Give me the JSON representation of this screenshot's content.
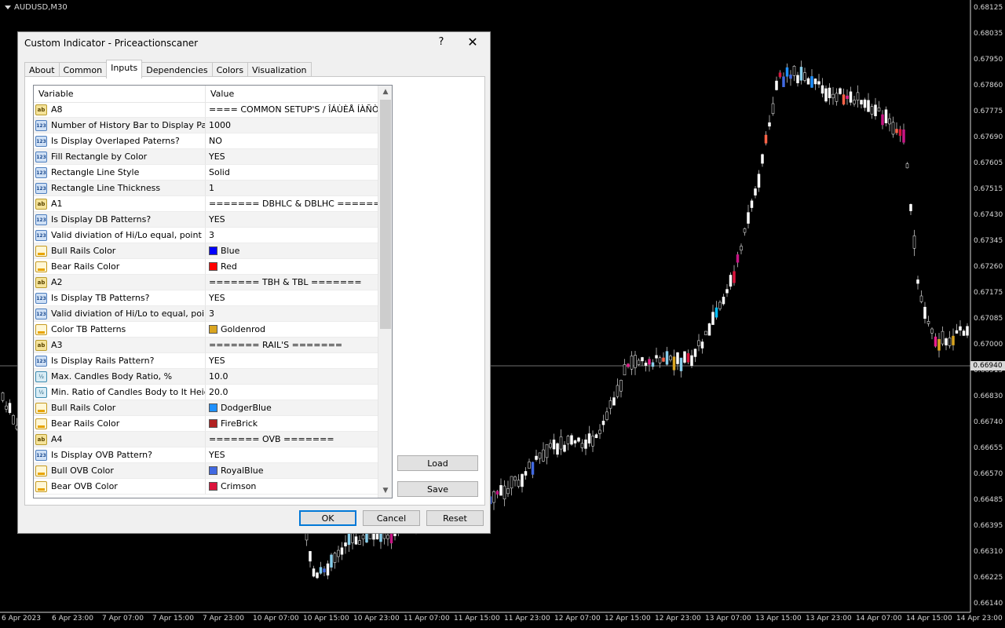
{
  "chart": {
    "symbol_title": "AUDUSD,M30",
    "current_price": "0.66940",
    "y_axis_labels": [
      "0.68125",
      "0.68035",
      "0.67950",
      "0.67860",
      "0.67775",
      "0.67690",
      "0.67605",
      "0.67515",
      "0.67430",
      "0.67345",
      "0.67260",
      "0.67175",
      "0.67085",
      "0.67000",
      "0.66915",
      "0.66830",
      "0.66740",
      "0.66655",
      "0.66570",
      "0.66485",
      "0.66395",
      "0.66310",
      "0.66225",
      "0.66140"
    ],
    "x_axis_labels": [
      "6 Apr 2023",
      "6 Apr 23:00",
      "7 Apr 07:00",
      "7 Apr 15:00",
      "7 Apr 23:00",
      "10 Apr 07:00",
      "10 Apr 15:00",
      "10 Apr 23:00",
      "11 Apr 07:00",
      "11 Apr 15:00",
      "11 Apr 23:00",
      "12 Apr 07:00",
      "12 Apr 15:00",
      "12 Apr 23:00",
      "13 Apr 07:00",
      "13 Apr 15:00",
      "13 Apr 23:00",
      "14 Apr 07:00",
      "14 Apr 15:00",
      "14 Apr 23:00"
    ]
  },
  "dialog": {
    "title": "Custom Indicator - Priceactionscaner",
    "help_label": "?",
    "close_label": "✕",
    "tabs": [
      "About",
      "Common",
      "Inputs",
      "Dependencies",
      "Colors",
      "Visualization"
    ],
    "active_tab": "Inputs",
    "grid": {
      "col_variable": "Variable",
      "col_value": "Value",
      "rows": [
        {
          "icon": "ab",
          "variable": "A8",
          "value": "==== COMMON SETUP'S / ÎÁÙÈÅ ÍÀÑÒ..."
        },
        {
          "icon": "123",
          "variable": "Number of History Bar to Display Patte...",
          "value": "1000"
        },
        {
          "icon": "123",
          "variable": "Is Display Overlaped Paterns?",
          "value": "NO"
        },
        {
          "icon": "123",
          "variable": "Fill Rectangle by Color",
          "value": "YES"
        },
        {
          "icon": "123",
          "variable": "Rectangle Line Style",
          "value": "Solid"
        },
        {
          "icon": "123",
          "variable": "Rectangle Line Thickness",
          "value": "1"
        },
        {
          "icon": "ab",
          "variable": "A1",
          "value": "======= DBHLC & DBLHC ======="
        },
        {
          "icon": "123",
          "variable": "Is Display DB Patterns?",
          "value": "YES"
        },
        {
          "icon": "123",
          "variable": "Valid diviation of Hi/Lo equal, point",
          "value": "3"
        },
        {
          "icon": "color",
          "variable": "Bull Rails Color",
          "value": "Blue",
          "swatch": "#0000ff"
        },
        {
          "icon": "color",
          "variable": "Bear Rails Color",
          "value": "Red",
          "swatch": "#ff0000"
        },
        {
          "icon": "ab",
          "variable": "A2",
          "value": "======= TBH & TBL ======="
        },
        {
          "icon": "123",
          "variable": "Is Display TB Patterns?",
          "value": "YES"
        },
        {
          "icon": "123",
          "variable": "Valid diviation of Hi/Lo to equal, point",
          "value": "3"
        },
        {
          "icon": "color",
          "variable": "Color TB Patterns",
          "value": "Goldenrod",
          "swatch": "#daa520"
        },
        {
          "icon": "ab",
          "variable": "A3",
          "value": "======= RAIL'S ======="
        },
        {
          "icon": "123",
          "variable": "Is Display Rails Pattern?",
          "value": "YES"
        },
        {
          "icon": "frac",
          "variable": "Max. Candles Body Ratio, %",
          "value": "10.0"
        },
        {
          "icon": "frac",
          "variable": "Min. Ratio of Candles Body to It Height...",
          "value": "20.0"
        },
        {
          "icon": "color",
          "variable": "Bull Rails Color",
          "value": "DodgerBlue",
          "swatch": "#1e90ff"
        },
        {
          "icon": "color",
          "variable": "Bear Rails Color",
          "value": "FireBrick",
          "swatch": "#b22222"
        },
        {
          "icon": "ab",
          "variable": "A4",
          "value": "======= OVB  ======="
        },
        {
          "icon": "123",
          "variable": "Is Display OVB Pattern?",
          "value": "YES"
        },
        {
          "icon": "color",
          "variable": "Bull OVB Color",
          "value": "RoyalBlue",
          "swatch": "#4169e1"
        },
        {
          "icon": "color",
          "variable": "Bear OVB Color",
          "value": "Crimson",
          "swatch": "#dc143c"
        }
      ]
    },
    "buttons": {
      "load": "Load",
      "save": "Save",
      "ok": "OK",
      "cancel": "Cancel",
      "reset": "Reset"
    }
  }
}
